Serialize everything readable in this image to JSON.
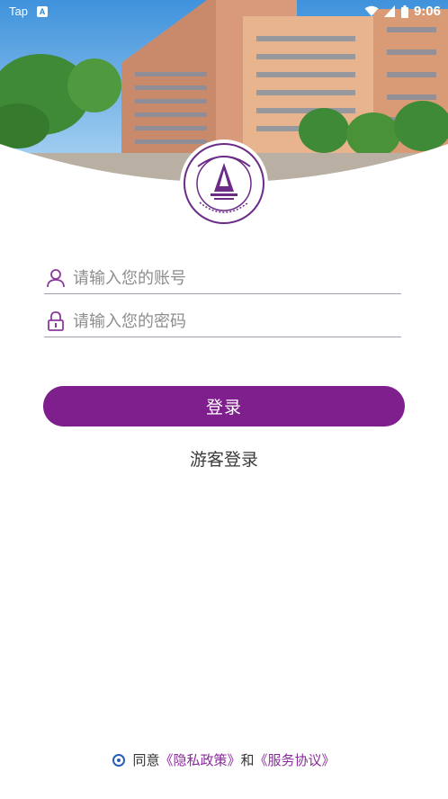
{
  "status_bar": {
    "carrier": "Tap",
    "time": "9:06"
  },
  "logo": {
    "emblem_text": "SHANGRAO NORMAL UNIVERSITY",
    "year": "1958"
  },
  "login": {
    "account_placeholder": "请输入您的账号",
    "password_placeholder": "请输入您的密码",
    "login_button": "登录",
    "guest_login": "游客登录"
  },
  "agreement": {
    "agree_text": "同意",
    "privacy_link": "《隐私政策》",
    "and_text": "和",
    "service_link": "《服务协议》"
  },
  "colors": {
    "primary": "#7f1f8e",
    "link": "#8a2a9c",
    "radio": "#2a5db8"
  }
}
